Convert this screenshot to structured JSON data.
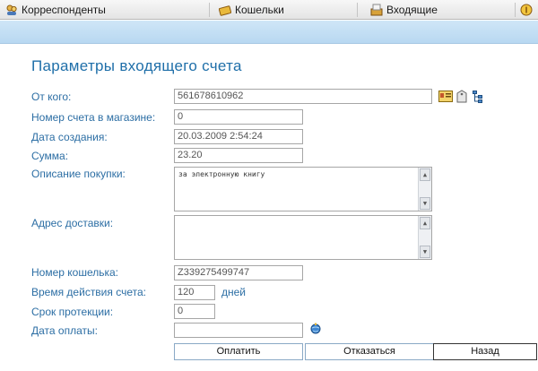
{
  "toolbar": {
    "items": [
      {
        "label": "Корреспонденты",
        "icon": "contacts-icon"
      },
      {
        "label": "Кошельки",
        "icon": "wallet-icon"
      },
      {
        "label": "Входящие",
        "icon": "inbox-icon"
      }
    ]
  },
  "page": {
    "title": "Параметры входящего счета"
  },
  "form": {
    "from": {
      "label": "От кого:",
      "value": "561678610962"
    },
    "order_number": {
      "label": "Номер счета в магазине:",
      "value": "0"
    },
    "created": {
      "label": "Дата создания:",
      "value": "20.03.2009 2:54:24"
    },
    "amount": {
      "label": "Сумма:",
      "value": "23.20"
    },
    "description": {
      "label": "Описание покупки:",
      "value": "за электронную книгу"
    },
    "address": {
      "label": "Адрес доставки:",
      "value": ""
    },
    "purse": {
      "label": "Номер кошелька:",
      "value": "Z339275499747"
    },
    "validity": {
      "label": "Время действия счета:",
      "value": "120",
      "unit": "дней"
    },
    "protection": {
      "label": "Срок протекции:",
      "value": "0"
    },
    "pay_date": {
      "label": "Дата оплаты:",
      "value": ""
    }
  },
  "buttons": {
    "pay": "Оплатить",
    "refuse": "Отказаться",
    "back": "Назад"
  },
  "colors": {
    "accent": "#1f6fa9",
    "label": "#2c6ea4",
    "band": "#c3def4"
  }
}
